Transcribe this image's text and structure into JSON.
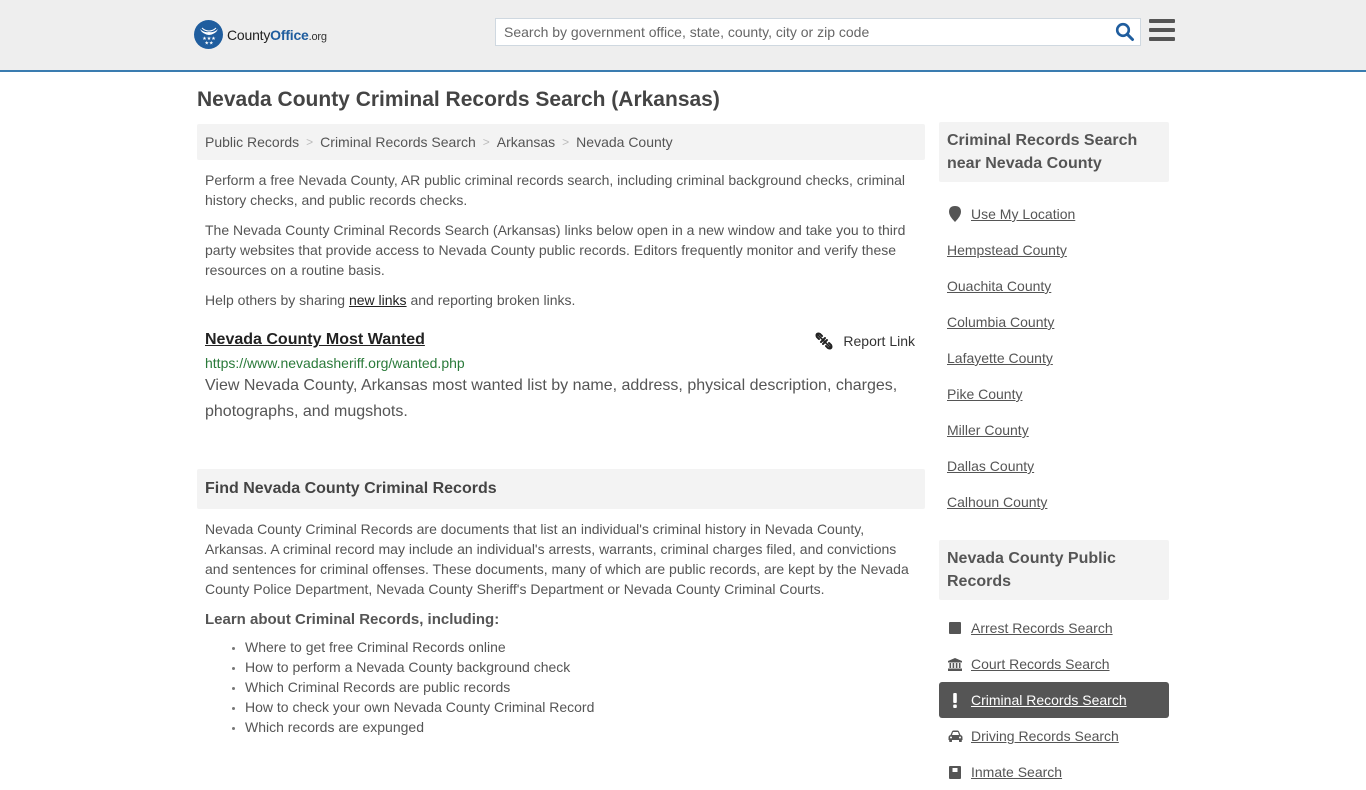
{
  "header": {
    "logo": {
      "part1": "County",
      "part2": "Office",
      "part3": ".org"
    },
    "search": {
      "placeholder": "Search by government office, state, county, city or zip code",
      "value": ""
    },
    "accent_color": "#3a7cb0",
    "brand_color": "#1f5d9e"
  },
  "page_title": "Nevada County Criminal Records Search (Arkansas)",
  "breadcrumb": [
    {
      "label": "Public Records"
    },
    {
      "label": "Criminal Records Search"
    },
    {
      "label": "Arkansas"
    },
    {
      "label": "Nevada County"
    }
  ],
  "intro": {
    "p1": "Perform a free Nevada County, AR public criminal records search, including criminal background checks, criminal history checks, and public records checks.",
    "p2": "The Nevada County Criminal Records Search (Arkansas) links below open in a new window and take you to third party websites that provide access to Nevada County public records. Editors frequently monitor and verify these resources on a routine basis.",
    "p3_before": "Help others by sharing ",
    "p3_link": "new links",
    "p3_after": " and reporting broken links."
  },
  "listing": {
    "title": "Nevada County Most Wanted",
    "report_label": "Report Link",
    "url": "https://www.nevadasheriff.org/wanted.php",
    "description": "View Nevada County, Arkansas most wanted list by name, address, physical description, charges, photographs, and mugshots."
  },
  "find_section": {
    "heading": "Find Nevada County Criminal Records",
    "body": "Nevada County Criminal Records are documents that list an individual's criminal history in Nevada County, Arkansas. A criminal record may include an individual's arrests, warrants, criminal charges filed, and convictions and sentences for criminal offenses. These documents, many of which are public records, are kept by the Nevada County Police Department, Nevada County Sheriff's Department or Nevada County Criminal Courts.",
    "learn_heading": "Learn about Criminal Records, including:",
    "learn_items": [
      "Where to get free Criminal Records online",
      "How to perform a Nevada County background check",
      "Which Criminal Records are public records",
      "How to check your own Nevada County Criminal Record",
      "Which records are expunged"
    ]
  },
  "sidebar": {
    "nearby": {
      "heading": "Criminal Records Search near Nevada County",
      "use_location": "Use My Location",
      "counties": [
        "Hempstead County",
        "Ouachita County",
        "Columbia County",
        "Lafayette County",
        "Pike County",
        "Miller County",
        "Dallas County",
        "Calhoun County"
      ]
    },
    "public_records": {
      "heading": "Nevada County Public Records",
      "items": [
        {
          "label": "Arrest Records Search",
          "icon": "square-icon",
          "active": false
        },
        {
          "label": "Court Records Search",
          "icon": "courthouse-icon",
          "active": false
        },
        {
          "label": "Criminal Records Search",
          "icon": "exclamation-icon",
          "active": true
        },
        {
          "label": "Driving Records Search",
          "icon": "car-icon",
          "active": false
        },
        {
          "label": "Inmate Search",
          "icon": "inmate-icon",
          "active": false
        }
      ]
    }
  }
}
